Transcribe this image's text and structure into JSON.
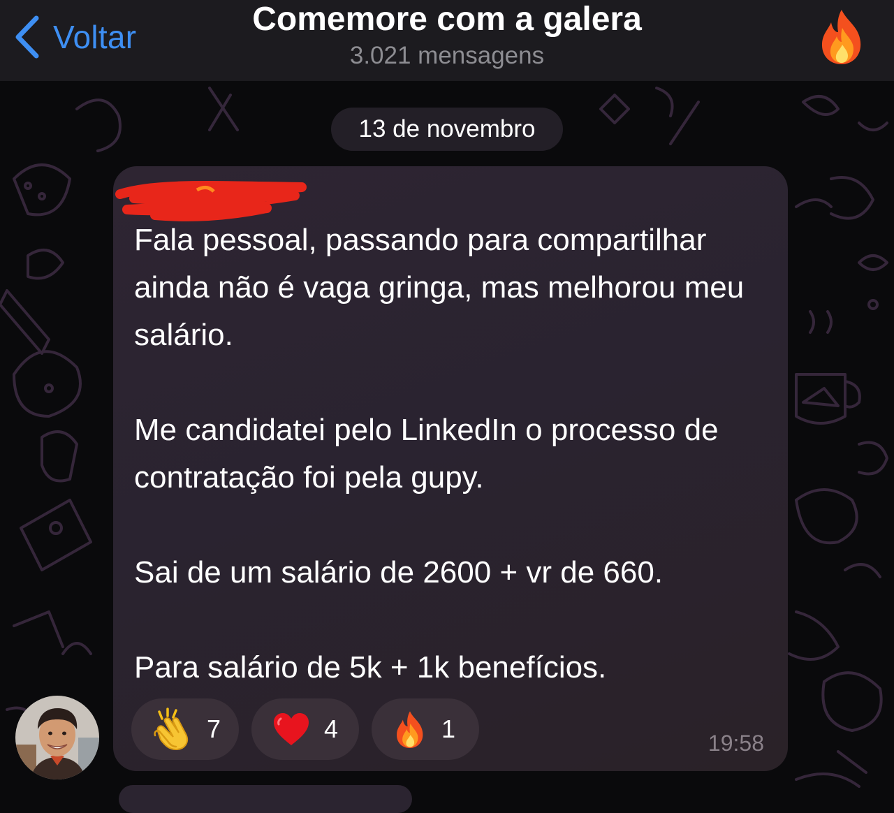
{
  "header": {
    "back_label": "Voltar",
    "title": "Comemore com a galera",
    "subtitle": "3.021 mensagens",
    "accent_color": "#3e8ff3",
    "chat_icon": "fire-icon"
  },
  "date_separator": "13 de novembro",
  "message": {
    "sender": "",
    "paragraphs": [
      "Fala pessoal, passando para compartilhar ainda não é vaga gringa, mas melhorou meu salário.",
      "Me candidatei pelo LinkedIn o processo de contratação foi pela gupy.",
      "Sai de um salário de  2600 + vr de 660.",
      "Para salário de 5k + 1k benefícios."
    ],
    "time": "19:58",
    "reactions": [
      {
        "icon": "clapping-hands-icon",
        "count": "7"
      },
      {
        "icon": "red-heart-icon",
        "count": "4"
      },
      {
        "icon": "fire-icon",
        "count": "1"
      }
    ]
  },
  "colors": {
    "background": "#0a0a0c",
    "header_bg": "#1c1b1f",
    "bubble_bg": "#2a2330",
    "reaction_bg": "#3a3039",
    "redaction": "#e8261a"
  }
}
